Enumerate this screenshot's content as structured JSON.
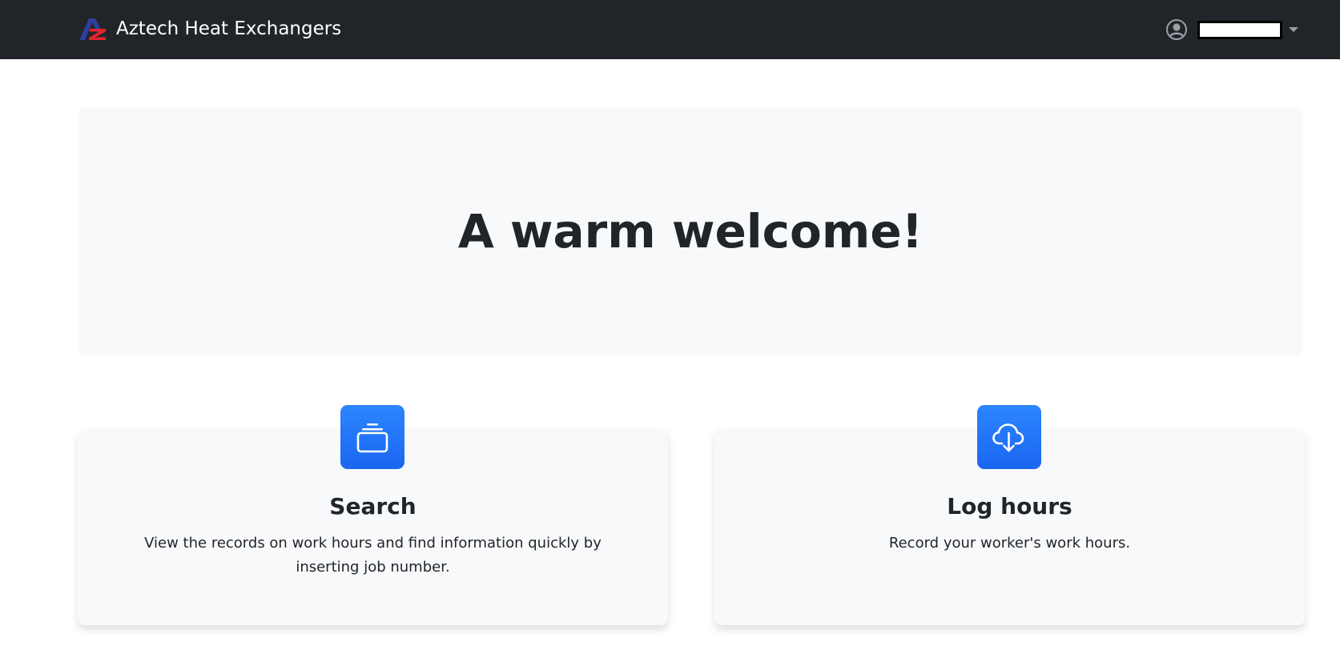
{
  "navbar": {
    "brand_name": "Aztech Heat Exchangers",
    "logo_icon": "aztech-az-logo",
    "user_icon": "person-circle-icon",
    "user_name": "",
    "user_menu_caret": "caret-down-icon"
  },
  "hero": {
    "title": "A warm welcome!"
  },
  "features": [
    {
      "icon": "collection-icon",
      "title": "Search",
      "description": "View the records on work hours and find information quickly by inserting job number."
    },
    {
      "icon": "cloud-download-icon",
      "title": "Log hours",
      "description": "Record your worker's work hours."
    }
  ],
  "colors": {
    "navbar_bg": "#212529",
    "accent": "#1f6ff5",
    "panel_bg": "#f8f9fa",
    "text": "#212529",
    "logo_blue": "#2f3d9e",
    "logo_red": "#e3242b"
  }
}
